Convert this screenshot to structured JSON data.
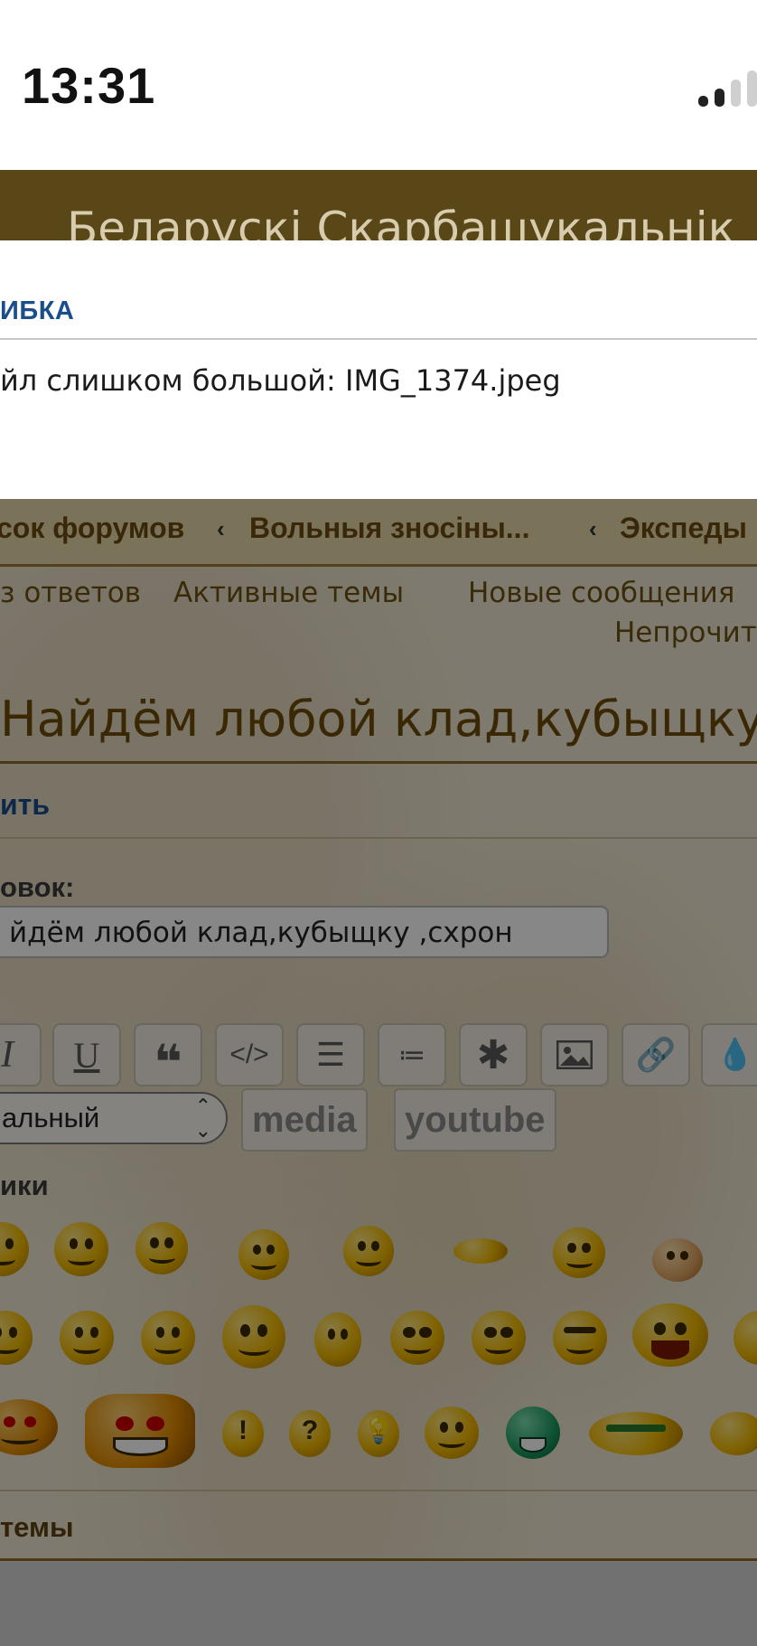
{
  "status_bar": {
    "time": "13:31"
  },
  "site": {
    "title": "Беларускі Скарбашукальнік"
  },
  "dialog": {
    "title": "ИБКА",
    "message": "йл слишком большой: IMG_1374.jpeg"
  },
  "breadcrumbs": [
    "сок форумов",
    "Вольныя зносіны...",
    "Экспеды"
  ],
  "quicklinks": [
    "з ответов",
    "Активные темы",
    "Новые сообщения",
    "Непрочит"
  ],
  "topic": {
    "title": "Найдём любой клад,кубыщку"
  },
  "reply": {
    "label": "ить"
  },
  "subject": {
    "label": "овок:",
    "value": "йдём любой клад,кубыщку ,схрон"
  },
  "toolbar": {
    "buttons": [
      "italic-icon",
      "underline-icon",
      "quote-icon",
      "code-icon",
      "list-icon",
      "ordered-list-icon",
      "asterisk-icon",
      "image-icon",
      "link-icon",
      "color-drop-icon"
    ],
    "font_size_select": "альный",
    "media_label": "media",
    "youtube_label": "youtube"
  },
  "smilies": {
    "label": "ики"
  },
  "topic_review": {
    "label": " темы"
  },
  "colors": {
    "header_bg": "#5a4718",
    "link_blue": "#1a4f8c",
    "crumb_bg": "#e8d7aa",
    "topic_title": "#6e4c08"
  }
}
